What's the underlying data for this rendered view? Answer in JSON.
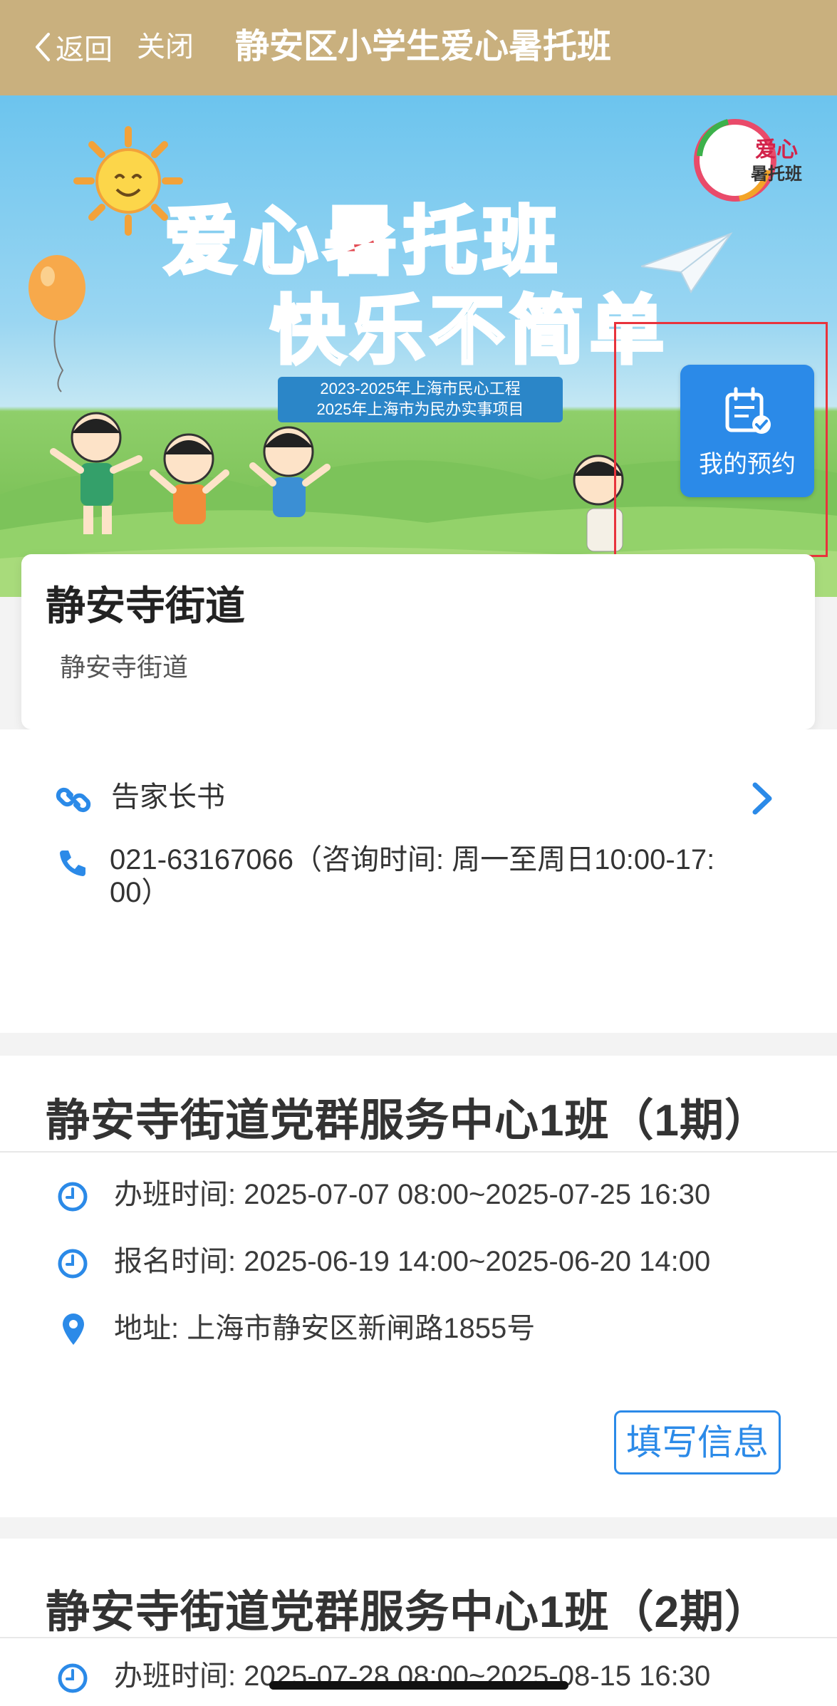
{
  "header": {
    "back_label": "返回",
    "close_label": "关闭",
    "title": "静安区小学生爱心暑托班"
  },
  "banner": {
    "title_line1": "爱心暑托班",
    "title_line2": "快乐不简单",
    "ribbon_line1": "2023-2025年上海市民心工程",
    "ribbon_line2": "2025年上海市为民办实事项目",
    "logo_line1": "爱心",
    "logo_line2": "暑托班"
  },
  "booking": {
    "label": "我的预约",
    "icon": "calendar-check-icon",
    "color": "#2b8ae8"
  },
  "street_card": {
    "title": "静安寺街道",
    "subtitle": "静安寺街道"
  },
  "info": {
    "parent_letter": "告家长书",
    "phone_line1": "021-63167066（咨询时间: 周一至周日10:00-17:",
    "phone_line2": "00）"
  },
  "classes": [
    {
      "title": "静安寺街道党群服务中心1班（1期）",
      "class_time": "办班时间: 2025-07-07 08:00~2025-07-25 16:30",
      "signup_time": "报名时间: 2025-06-19 14:00~2025-06-20 14:00",
      "address": "地址: 上海市静安区新闸路1855号",
      "button_label": "填写信息"
    },
    {
      "title": "静安寺街道党群服务中心1班（2期）",
      "class_time": "办班时间: 2025-07-28 08:00~2025-08-15 16:30"
    }
  ],
  "colors": {
    "header_bg": "#c9b07e",
    "accent": "#2b8ae8",
    "highlight_box": "#e8333c"
  }
}
